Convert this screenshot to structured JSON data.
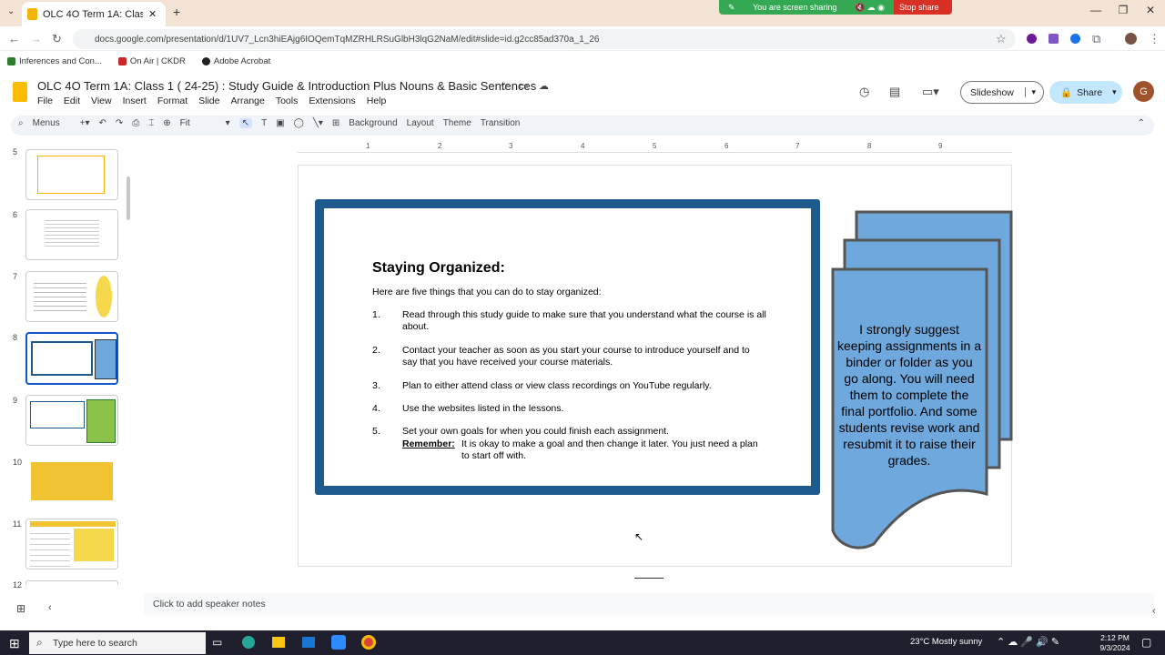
{
  "browser": {
    "tab_title": "OLC 4O Term 1A: Class 1 (24-2...",
    "url": "docs.google.com/presentation/d/1UV7_Lcn3hiEAjg6IOQemTqMZRHLRSuGlbH3lqG2NaM/edit#slide=id.g2cc85ad370a_1_26",
    "screen_share_text": "You are screen sharing",
    "stop_share": "Stop share",
    "bookmarks": [
      "Inferences and Con...",
      "On Air | CKDR",
      "Adobe Acrobat"
    ]
  },
  "doc": {
    "title": "OLC 4O Term 1A: Class 1 ( 24-25) : Study Guide & Introduction Plus Nouns & Basic Sentences",
    "menu": [
      "File",
      "Edit",
      "View",
      "Insert",
      "Format",
      "Slide",
      "Arrange",
      "Tools",
      "Extensions",
      "Help"
    ],
    "slideshow_label": "Slideshow",
    "share_label": "Share",
    "avatar_letter": "G"
  },
  "toolbar": {
    "menus_label": "Menus",
    "zoom_label": "Fit",
    "background": "Background",
    "layout": "Layout",
    "theme": "Theme",
    "transition": "Transition"
  },
  "ruler_marks": [
    "1",
    "2",
    "3",
    "4",
    "5",
    "6",
    "7",
    "8",
    "9"
  ],
  "filmstrip": {
    "numbers": [
      "5",
      "6",
      "7",
      "8",
      "9",
      "10",
      "11",
      "12"
    ],
    "active": "8"
  },
  "slide": {
    "title": "Staying Organized:",
    "intro": "Here are five things that you can do to stay organized:",
    "items": [
      {
        "n": "1.",
        "text": "Read through this study guide to make sure that you understand what the course is all about."
      },
      {
        "n": "2.",
        "text": "Contact your teacher as soon as you start your course to introduce yourself and to say that you have received your course materials."
      },
      {
        "n": "3.",
        "text": "Plan to either attend class or view class recordings on YouTube regularly."
      },
      {
        "n": "4.",
        "text": "Use the websites listed in the lessons."
      },
      {
        "n": "5.",
        "text": "Set your own goals for when you could finish each assignment."
      }
    ],
    "remember_label": "Remember:",
    "remember_text": "It is okay to make a goal and then change it later. You just need a plan to start off with.",
    "callout": "I strongly suggest keeping assignments in a binder or folder as you go along. You will need them to complete the final portfolio. And some students revise work and resubmit it to raise their grades."
  },
  "notes_placeholder": "Click to add speaker notes",
  "taskbar": {
    "search_placeholder": "Type here to search",
    "weather": "23°C  Mostly sunny",
    "time": "2:12 PM",
    "date": "9/3/2024"
  },
  "colors": {
    "card_border": "#1e5a8e",
    "callout_fill": "#6fa8dc",
    "share_green": "#34a853",
    "stop_red": "#d93025"
  }
}
